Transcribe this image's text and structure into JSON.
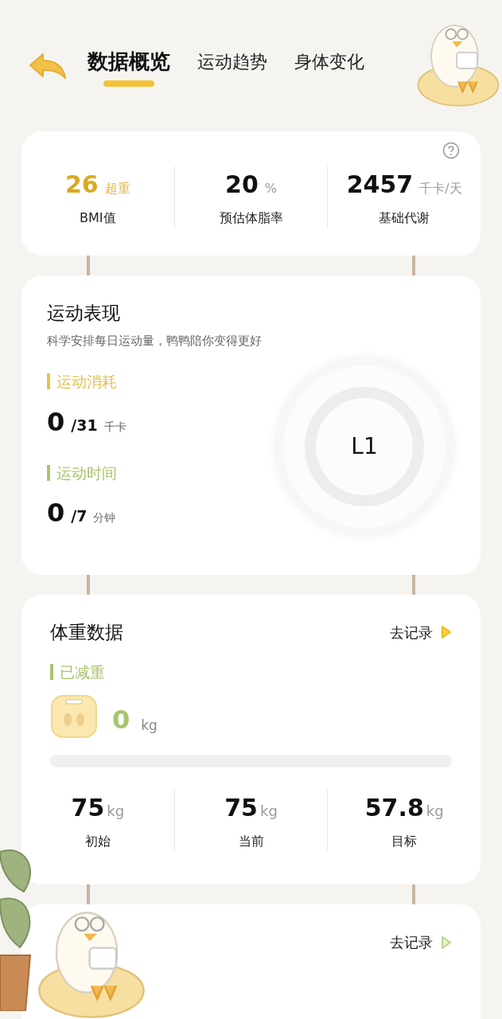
{
  "tabs": [
    {
      "label": "数据概览",
      "selected": true
    },
    {
      "label": "运动趋势",
      "selected": false
    },
    {
      "label": "身体变化",
      "selected": false
    }
  ],
  "summary": {
    "stats": [
      {
        "value": "26",
        "unit": "超重",
        "label": "BMI值",
        "kind": "highlight"
      },
      {
        "value": "20",
        "unit": "%",
        "label": "预估体脂率",
        "kind": "plain"
      },
      {
        "value": "2457",
        "unit": "千卡/天",
        "label": "基础代谢",
        "kind": "plain"
      }
    ]
  },
  "exercise": {
    "title": "运动表现",
    "subtitle": "科学安排每日运动量，鸭鸭陪你变得更好",
    "metrics": [
      {
        "label": "运动消耗",
        "color": "#e6c14a",
        "value": "0",
        "target": "/31",
        "unit": "千卡"
      },
      {
        "label": "运动时间",
        "color": "#a8c46e",
        "value": "0",
        "target": "/7",
        "unit": "分钟"
      }
    ],
    "level_badge": "L1"
  },
  "weight": {
    "title": "体重数据",
    "record_link": "去记录",
    "lost_label": "已减重",
    "lost_value": "0",
    "lost_unit": "kg",
    "progress": {
      "level": 0
    },
    "stats": [
      {
        "value": "75",
        "unit": "kg",
        "label": "初始"
      },
      {
        "value": "75",
        "unit": "kg",
        "label": "当前"
      },
      {
        "value": "57.8",
        "unit": "kg",
        "label": "目标"
      }
    ]
  },
  "next_card": {
    "record_link": "去记录"
  }
}
